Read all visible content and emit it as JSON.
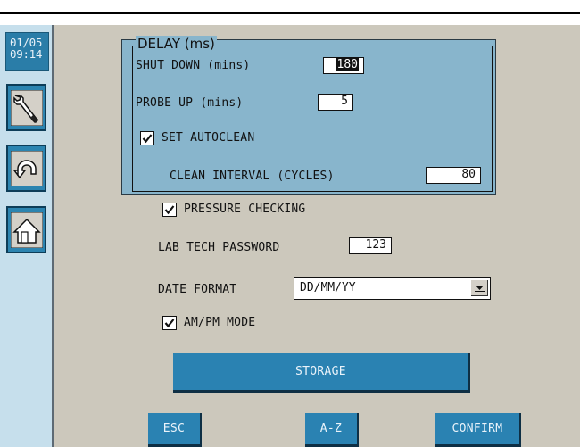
{
  "clock": {
    "date": "01/05",
    "time": "09:14"
  },
  "sidebar": [
    {
      "icon": "wrench-icon"
    },
    {
      "icon": "undo-icon"
    },
    {
      "icon": "home-icon"
    }
  ],
  "delay_group": {
    "legend": "DELAY (ms)",
    "shutdown_label": "SHUT DOWN (mins)",
    "shutdown_value": "180",
    "probe_up_label": "PROBE UP (mins)",
    "probe_up_value": "5",
    "autoclean_label": "SET AUTOCLEAN",
    "autoclean_checked": true,
    "clean_interval_label": "CLEAN INTERVAL (CYCLES)",
    "clean_interval_value": "80"
  },
  "pressure_checking": {
    "label": "PRESSURE CHECKING",
    "checked": true
  },
  "lab_tech_password": {
    "label": "LAB TECH PASSWORD",
    "value": "123"
  },
  "date_format": {
    "label": "DATE FORMAT",
    "value": "DD/MM/YY"
  },
  "ampm_mode": {
    "label": "AM/PM MODE",
    "checked": true
  },
  "buttons": {
    "storage": "STORAGE",
    "esc": "ESC",
    "az": "A-Z",
    "confirm": "CONFIRM"
  },
  "colors": {
    "sidebar": "#c6dfec",
    "panel": "#88b5cc",
    "button": "#2a82b2",
    "background": "#ccc8bc"
  }
}
